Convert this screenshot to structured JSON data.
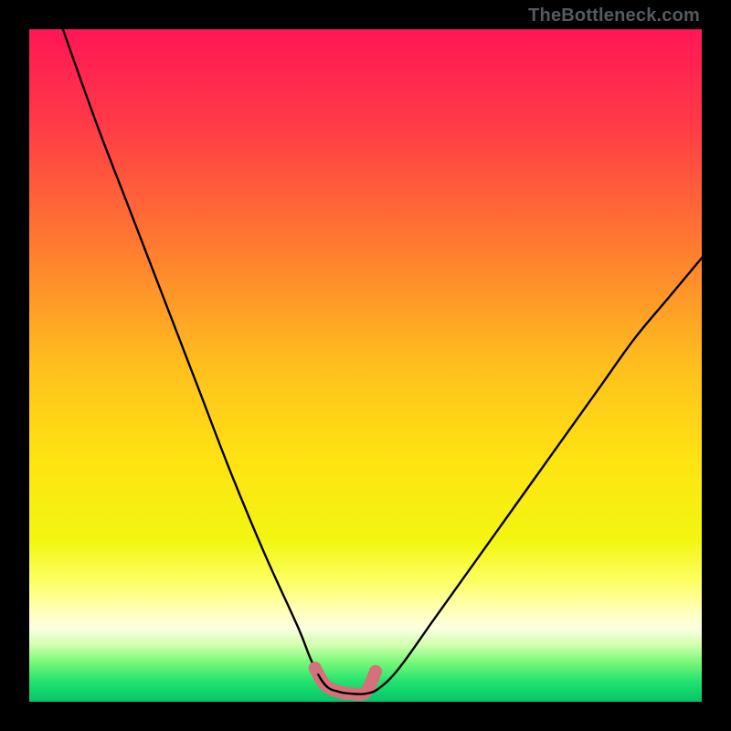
{
  "watermark": "TheBottleneck.com",
  "chart_data": {
    "type": "line",
    "title": "",
    "xlabel": "",
    "ylabel": "",
    "xlim": [
      0,
      100
    ],
    "ylim": [
      0,
      100
    ],
    "series": [
      {
        "name": "bottleneck-curve",
        "x": [
          5,
          10,
          15,
          20,
          25,
          30,
          35,
          40,
          42,
          44,
          46,
          48,
          50,
          52,
          55,
          60,
          65,
          70,
          75,
          80,
          85,
          90,
          95,
          100
        ],
        "y": [
          100,
          86,
          73,
          60,
          47,
          34,
          22,
          11,
          6,
          2.5,
          1.5,
          1.2,
          1.2,
          2.0,
          5,
          12,
          19,
          26,
          33,
          40,
          47,
          54,
          60,
          66
        ]
      },
      {
        "name": "optimal-band",
        "x": [
          42.5,
          44,
          46,
          48,
          50,
          51.5
        ],
        "y": [
          5.0,
          2.5,
          1.5,
          1.2,
          1.4,
          4.5
        ]
      }
    ],
    "gradient_stops": [
      {
        "pct": 0,
        "color": "#ff1656"
      },
      {
        "pct": 14,
        "color": "#ff3a47"
      },
      {
        "pct": 32,
        "color": "#ff7a30"
      },
      {
        "pct": 50,
        "color": "#ffbf1e"
      },
      {
        "pct": 64,
        "color": "#ffe312"
      },
      {
        "pct": 76,
        "color": "#f2f610"
      },
      {
        "pct": 82,
        "color": "#fdff62"
      },
      {
        "pct": 86,
        "color": "#ffffb0"
      },
      {
        "pct": 89,
        "color": "#fcffe0"
      },
      {
        "pct": 91.5,
        "color": "#d3ffb0"
      },
      {
        "pct": 94,
        "color": "#7cf97a"
      },
      {
        "pct": 97,
        "color": "#22e36e"
      },
      {
        "pct": 100,
        "color": "#03c56b"
      }
    ],
    "colors": {
      "curve": "#000000",
      "band": "#d6707a"
    }
  }
}
